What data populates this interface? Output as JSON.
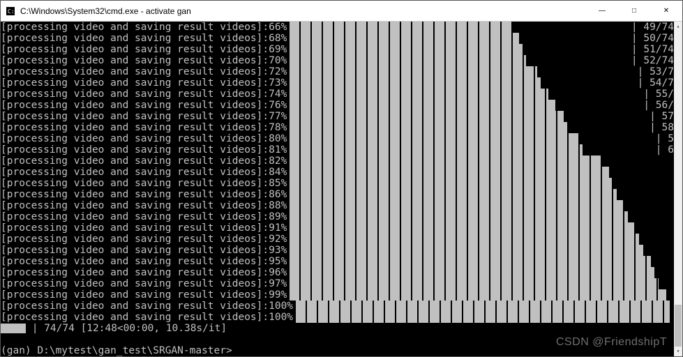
{
  "window": {
    "title": "C:\\Windows\\System32\\cmd.exe - activate  gan"
  },
  "controls": {
    "minimize": "—",
    "maximize": "□",
    "close": "✕"
  },
  "progress_label": "[processing video and saving result videos]:",
  "lines": [
    {
      "pct": "66%",
      "fill": 66,
      "counter": "49/74"
    },
    {
      "pct": "68%",
      "fill": 68,
      "counter": "50/74"
    },
    {
      "pct": "69%",
      "fill": 69,
      "counter": "51/74"
    },
    {
      "pct": "70%",
      "fill": 70,
      "counter": "52/74"
    },
    {
      "pct": "72%",
      "fill": 72,
      "counter": "53/7"
    },
    {
      "pct": "73%",
      "fill": 73,
      "counter": "54/7"
    },
    {
      "pct": "74%",
      "fill": 74,
      "counter": "55/"
    },
    {
      "pct": "76%",
      "fill": 76,
      "counter": "56/"
    },
    {
      "pct": "77%",
      "fill": 77,
      "counter": "57"
    },
    {
      "pct": "78%",
      "fill": 78,
      "counter": "58"
    },
    {
      "pct": "80%",
      "fill": 80,
      "counter": "5"
    },
    {
      "pct": "81%",
      "fill": 81,
      "counter": "6"
    },
    {
      "pct": "82%",
      "fill": 82,
      "counter": ""
    },
    {
      "pct": "84%",
      "fill": 84,
      "counter": ""
    },
    {
      "pct": "85%",
      "fill": 85,
      "counter": ""
    },
    {
      "pct": "86%",
      "fill": 86,
      "counter": ""
    },
    {
      "pct": "88%",
      "fill": 88,
      "counter": ""
    },
    {
      "pct": "89%",
      "fill": 89,
      "counter": ""
    },
    {
      "pct": "91%",
      "fill": 91,
      "counter": ""
    },
    {
      "pct": "92%",
      "fill": 92,
      "counter": ""
    },
    {
      "pct": "93%",
      "fill": 93,
      "counter": ""
    },
    {
      "pct": "95%",
      "fill": 95,
      "counter": ""
    },
    {
      "pct": "96%",
      "fill": 96,
      "counter": ""
    },
    {
      "pct": "97%",
      "fill": 97,
      "counter": ""
    },
    {
      "pct": "99%",
      "fill": 99,
      "counter": ""
    },
    {
      "pct": "100%",
      "fill": 100,
      "counter": ""
    },
    {
      "pct": "100%",
      "fill": 100,
      "counter": ""
    }
  ],
  "summary_line": "| 74/74 [12:48<00:00, 10.38s/it]",
  "blank_line": "",
  "prompt_line": "(gan) D:\\mytest\\gan_test\\SRGAN-master>",
  "watermark": "CSDN @FriendshipT"
}
